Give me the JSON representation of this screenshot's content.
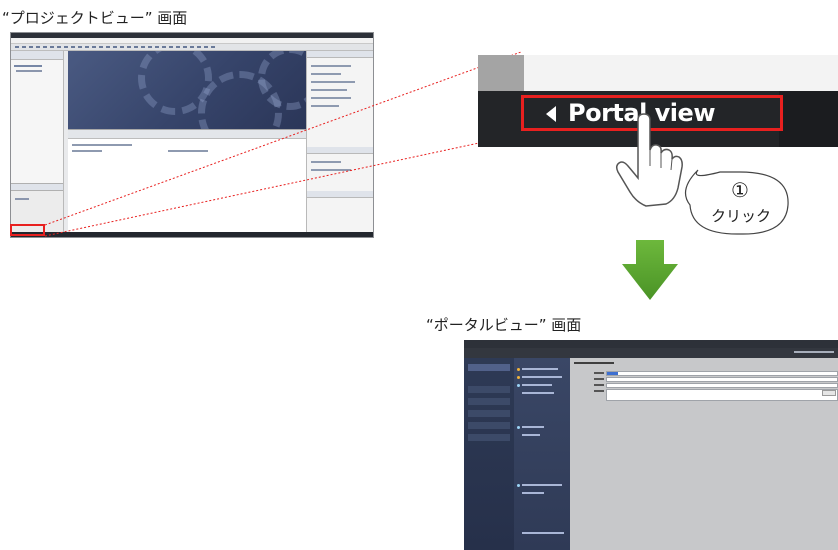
{
  "captions": {
    "project_view": "“プロジェクトビュー” 画面",
    "portal_view": "“ポータルビュー” 画面"
  },
  "zoom": {
    "button_label": "Portal view"
  },
  "callout": {
    "number": "①",
    "text": "クリック"
  },
  "colors": {
    "highlight_red": "#e8201f",
    "arrow_green": "#5aa52e",
    "portal_panel_blue": "#2e3a55",
    "workarea_blue": "#3f4d76"
  },
  "icons": {
    "hand_cursor": "hand-pointer-icon",
    "arrow": "down-arrow-icon",
    "triangle": "left-triangle-icon"
  }
}
